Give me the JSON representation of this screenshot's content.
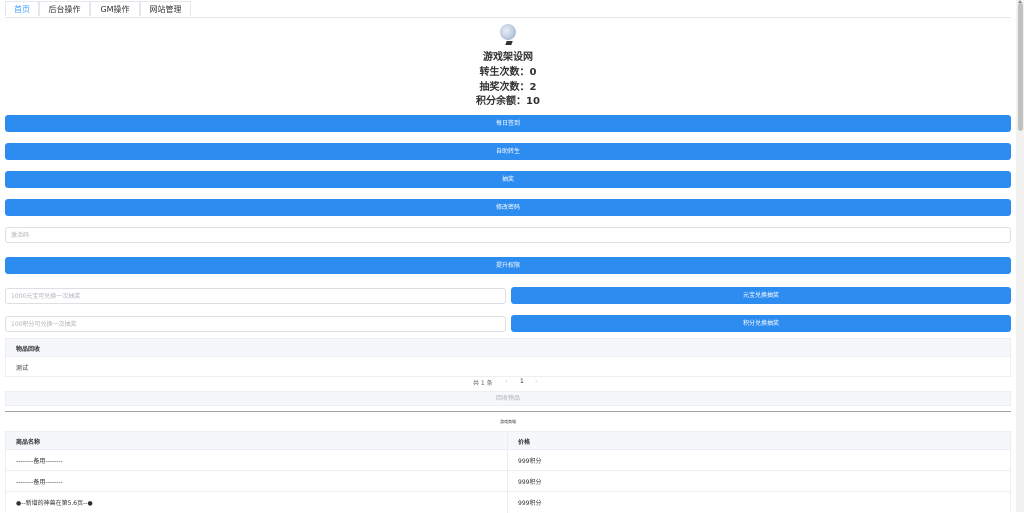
{
  "tabs": [
    "首页",
    "后台操作",
    "GM操作",
    "网站管理"
  ],
  "profile": {
    "site_name": "游戏架设网",
    "rebirth": "转生次数：0",
    "lottery": "抽奖次数：2",
    "points": "积分余额：10"
  },
  "buttons": {
    "daily_checkin": "每日签到",
    "auto_rebirth": "自助转生",
    "lottery": "抽奖",
    "change_password": "修改密码",
    "upgrade": "提升权限",
    "yuanbao_exchange": "元宝兑换抽奖",
    "points_exchange": "积分兑换抽奖",
    "recycle": "回收物品"
  },
  "inputs": {
    "invite_placeholder": "激活码",
    "yuanbao_placeholder": "1000元宝可兑换一次抽奖",
    "points_placeholder": "100积分可兑换一次抽奖"
  },
  "recycle_table": {
    "header": "物品回收",
    "rows": [
      "测试"
    ]
  },
  "pagination": {
    "total": "共 1 条",
    "prev": "‹",
    "page": "1",
    "next": "›"
  },
  "shop": {
    "title": "游戏商城",
    "headers": [
      "商品名称",
      "价格"
    ],
    "rows": [
      [
        "--------备用--------",
        "999积分"
      ],
      [
        "--------备用--------",
        "999积分"
      ],
      [
        "●--新增的神兽在第5.6页--●",
        "999积分"
      ]
    ]
  },
  "colors": {
    "accent": "#409eff",
    "button": "#2d8cf0"
  }
}
